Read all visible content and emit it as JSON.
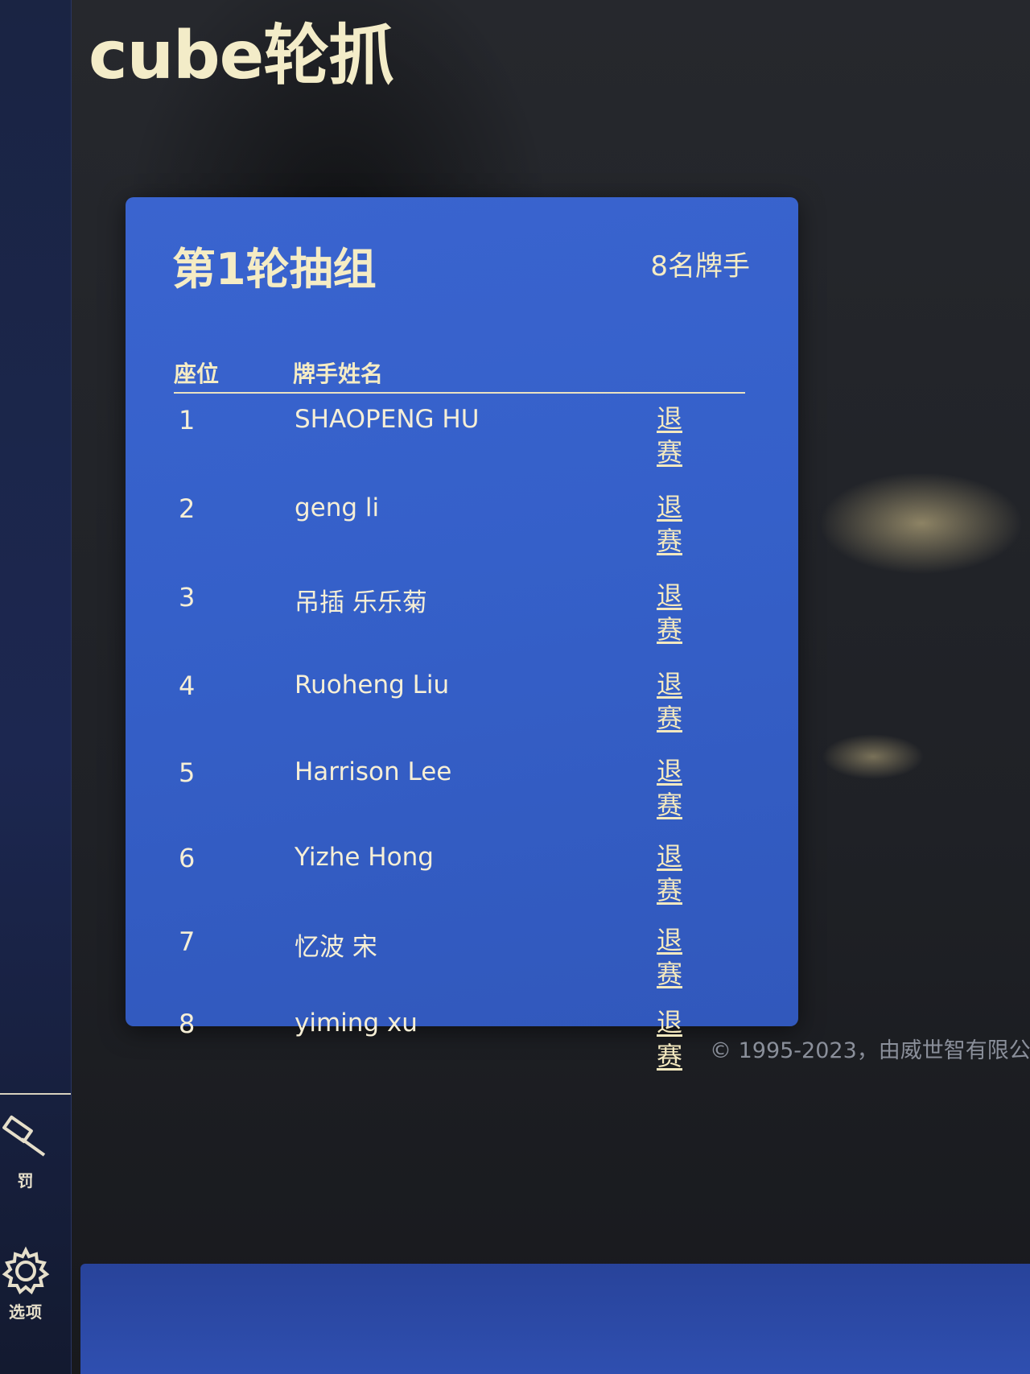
{
  "app": {
    "title": "cube轮抓"
  },
  "sidebar": {
    "items": [
      {
        "label": "罚",
        "icon": "gavel-icon"
      },
      {
        "label": "选项",
        "icon": "gear-icon"
      }
    ]
  },
  "panel": {
    "title": "第1轮抽组",
    "player_count": "8名牌手",
    "headers": {
      "seat": "座位",
      "name": "牌手姓名"
    },
    "withdraw_label": "退赛",
    "rows": [
      {
        "seat": "1",
        "name": "SHAOPENG HU"
      },
      {
        "seat": "2",
        "name": "geng li"
      },
      {
        "seat": "3",
        "name": "吊插 乐乐菊"
      },
      {
        "seat": "4",
        "name": "Ruoheng Liu"
      },
      {
        "seat": "5",
        "name": "Harrison Lee"
      },
      {
        "seat": "6",
        "name": "Yizhe Hong"
      },
      {
        "seat": "7",
        "name": "忆波 宋"
      },
      {
        "seat": "8",
        "name": "yiming xu"
      }
    ]
  },
  "footer": {
    "copyright": "© 1995-2023，由威世智有限公"
  },
  "colors": {
    "panel_blue": "#3560c9",
    "text_cream": "#f5ecc4",
    "sidebar_navy": "#1c2750"
  }
}
